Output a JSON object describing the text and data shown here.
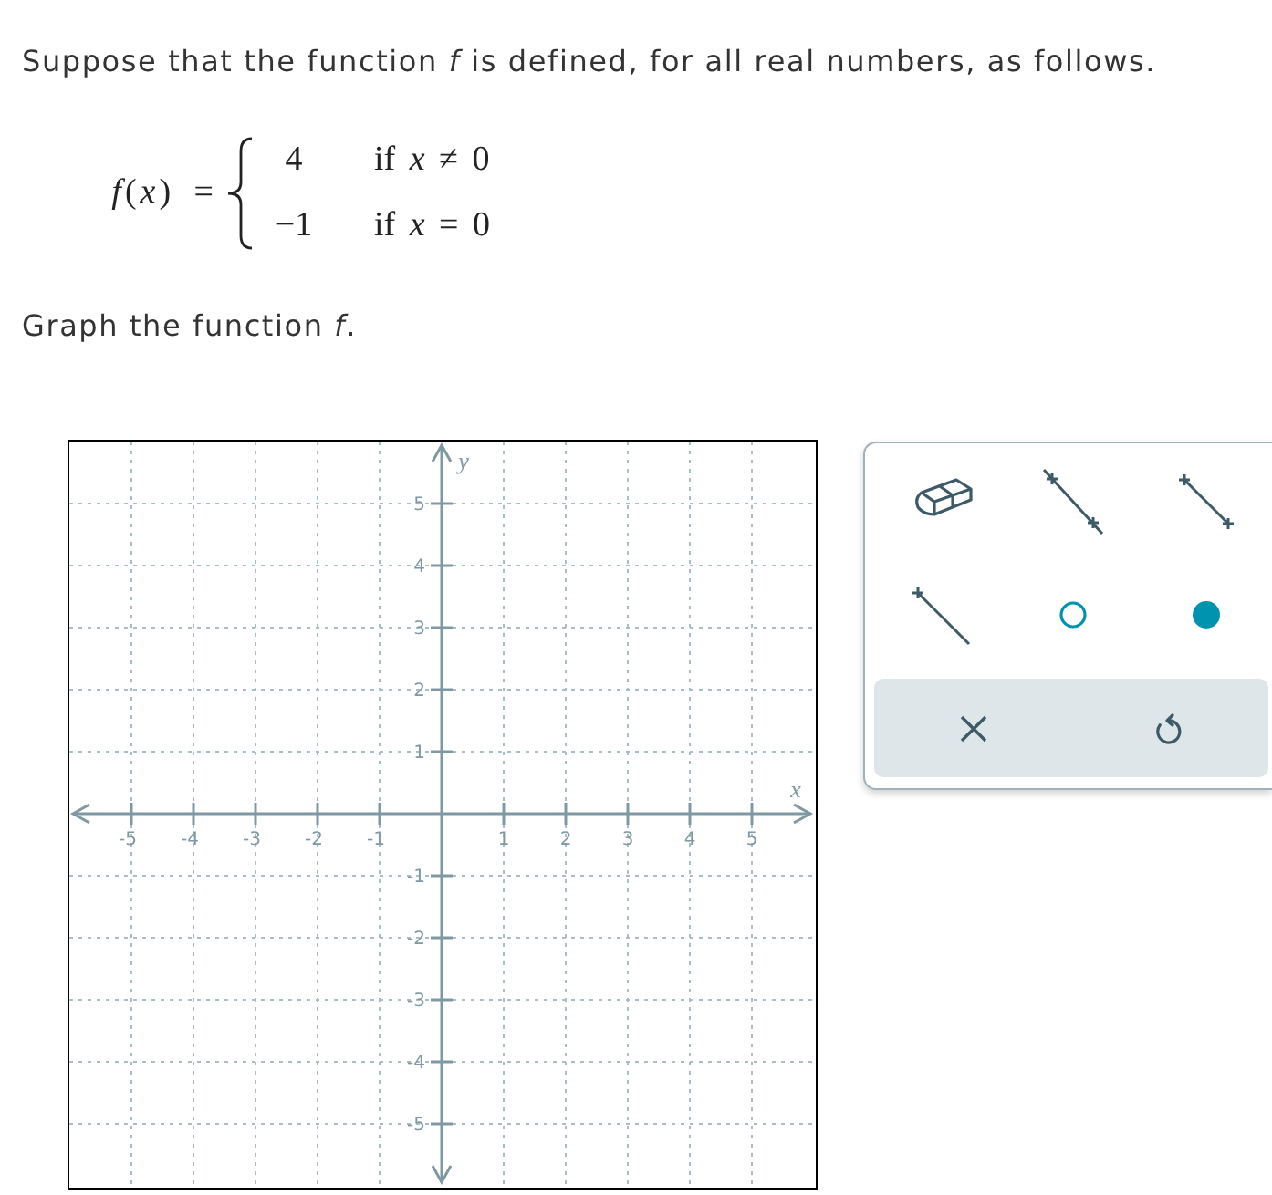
{
  "prompt": "Suppose that the function *f* is defined, for all real numbers, as follows.",
  "formula": {
    "lhs": "*f*(*x*) =",
    "cases": [
      {
        "value": "4",
        "condition": "if *x* ≠ 0"
      },
      {
        "value": "−1",
        "condition": "if *x* = 0"
      }
    ]
  },
  "instruction": "Graph the function *f*.",
  "graph": {
    "chart_data": {
      "type": "scatter",
      "xlabel": "x",
      "ylabel": "y",
      "xlim": [
        -6,
        6
      ],
      "ylim": [
        -6,
        6
      ],
      "xticks": [
        -5,
        -4,
        -3,
        -2,
        -1,
        1,
        2,
        3,
        4,
        5
      ],
      "yticks": [
        -5,
        -4,
        -3,
        -2,
        -1,
        1,
        2,
        3,
        4,
        5
      ],
      "grid": true
    }
  },
  "toolbar": {
    "tools": [
      {
        "kind": "eraser",
        "selected": false
      },
      {
        "kind": "line",
        "selected": false
      },
      {
        "kind": "segment",
        "selected": false
      },
      {
        "kind": "ray",
        "selected": false
      },
      {
        "kind": "open-point",
        "selected": false
      },
      {
        "kind": "closed-point",
        "selected": false
      }
    ],
    "actions": [
      {
        "kind": "clear"
      },
      {
        "kind": "undo"
      }
    ]
  }
}
